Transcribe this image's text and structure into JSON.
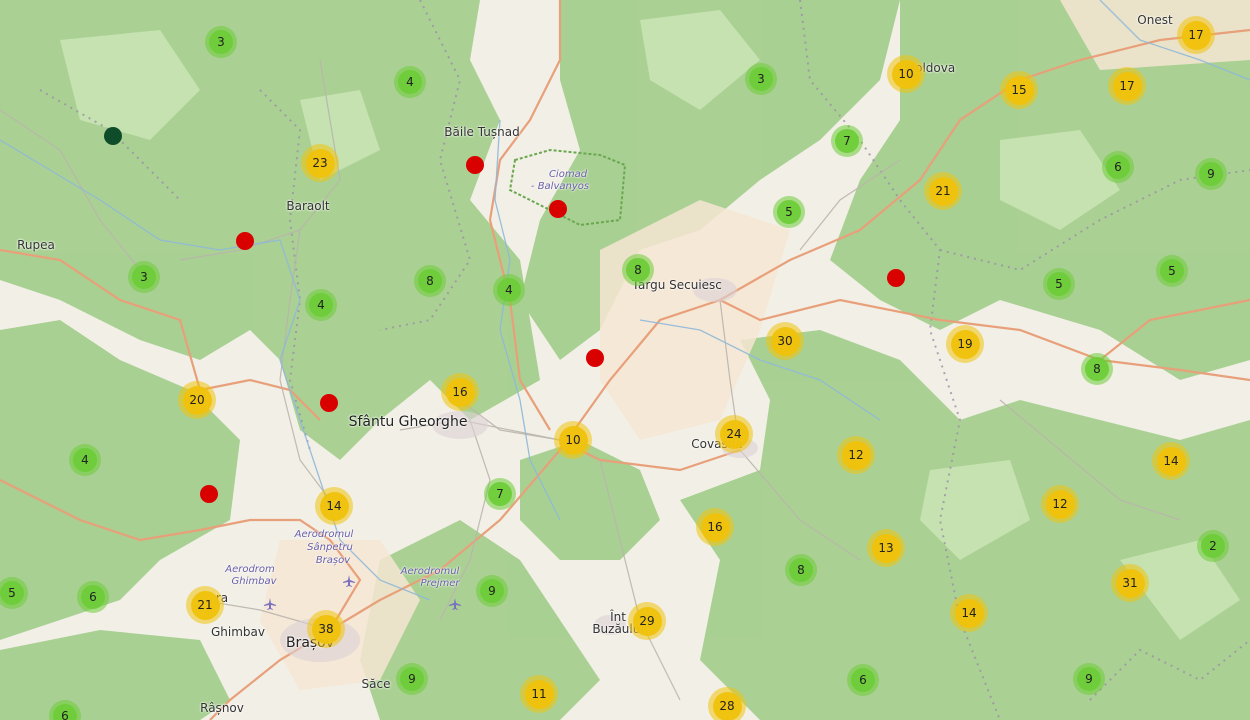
{
  "colors": {
    "green_cluster": "#6ecc39",
    "yellow_cluster": "#f0c20c",
    "red_marker": "#d90000",
    "darkgreen_marker": "#0f4d2a",
    "forest": "#a5cf8e",
    "land": "#f2efe6"
  },
  "places": [
    {
      "name": "Băile Tușnad",
      "cls": "city"
    },
    {
      "name": "Ciomad",
      "cls": "italic"
    },
    {
      "name": "- Balvanyos",
      "cls": "italic"
    },
    {
      "name": "Baraolt",
      "cls": "city"
    },
    {
      "name": "Rupea",
      "cls": "city"
    },
    {
      "name": "Moldova",
      "cls": "city"
    },
    {
      "name": "Onest",
      "cls": "city"
    },
    {
      "name": "Târgu Secuiesc",
      "cls": "city"
    },
    {
      "name": "Sfântu Gheorghe",
      "cls": "big"
    },
    {
      "name": "Covasna",
      "cls": "city"
    },
    {
      "name": "Aerodromul",
      "cls": "italic"
    },
    {
      "name": "Sânpetru",
      "cls": "italic"
    },
    {
      "name": "Brașov",
      "cls": "italic"
    },
    {
      "name": "Aerodrom",
      "cls": "italic"
    },
    {
      "name": "Ghimbav",
      "cls": "italic"
    },
    {
      "name": "Aerodromul",
      "cls": "italic"
    },
    {
      "name": "Prejmer",
      "cls": "italic"
    },
    {
      "name": "Ghimbav",
      "cls": "city"
    },
    {
      "name": "Brașov",
      "cls": "big"
    },
    {
      "name": "Înt",
      "cls": "city"
    },
    {
      "name": "Buzăului",
      "cls": "city"
    },
    {
      "name": "Săce",
      "cls": "city"
    },
    {
      "name": "Râșnov",
      "cls": "city"
    },
    {
      "name": "ra",
      "cls": "city"
    }
  ],
  "clusters": [
    {
      "count": "3",
      "level": "green"
    },
    {
      "count": "4",
      "level": "green"
    },
    {
      "count": "3",
      "level": "green"
    },
    {
      "count": "10",
      "level": "yellow"
    },
    {
      "count": "15",
      "level": "yellow"
    },
    {
      "count": "17",
      "level": "yellow"
    },
    {
      "count": "17",
      "level": "yellow"
    },
    {
      "count": "23",
      "level": "yellow"
    },
    {
      "count": "7",
      "level": "green"
    },
    {
      "count": "6",
      "level": "green"
    },
    {
      "count": "9",
      "level": "green"
    },
    {
      "count": "21",
      "level": "yellow"
    },
    {
      "count": "5",
      "level": "green"
    },
    {
      "count": "3",
      "level": "green"
    },
    {
      "count": "8",
      "level": "green"
    },
    {
      "count": "4",
      "level": "green"
    },
    {
      "count": "8",
      "level": "green"
    },
    {
      "count": "5",
      "level": "green"
    },
    {
      "count": "5",
      "level": "green"
    },
    {
      "count": "4",
      "level": "green"
    },
    {
      "count": "30",
      "level": "yellow"
    },
    {
      "count": "19",
      "level": "yellow"
    },
    {
      "count": "8",
      "level": "green"
    },
    {
      "count": "20",
      "level": "yellow"
    },
    {
      "count": "16",
      "level": "yellow"
    },
    {
      "count": "10",
      "level": "yellow"
    },
    {
      "count": "24",
      "level": "yellow"
    },
    {
      "count": "12",
      "level": "yellow"
    },
    {
      "count": "14",
      "level": "yellow"
    },
    {
      "count": "4",
      "level": "green"
    },
    {
      "count": "7",
      "level": "green"
    },
    {
      "count": "14",
      "level": "yellow"
    },
    {
      "count": "12",
      "level": "yellow"
    },
    {
      "count": "16",
      "level": "yellow"
    },
    {
      "count": "13",
      "level": "yellow"
    },
    {
      "count": "2",
      "level": "green"
    },
    {
      "count": "5",
      "level": "green"
    },
    {
      "count": "6",
      "level": "green"
    },
    {
      "count": "21",
      "level": "yellow"
    },
    {
      "count": "8",
      "level": "green"
    },
    {
      "count": "9",
      "level": "green"
    },
    {
      "count": "31",
      "level": "yellow"
    },
    {
      "count": "29",
      "level": "yellow"
    },
    {
      "count": "14",
      "level": "yellow"
    },
    {
      "count": "38",
      "level": "yellow"
    },
    {
      "count": "9",
      "level": "green"
    },
    {
      "count": "11",
      "level": "yellow"
    },
    {
      "count": "28",
      "level": "yellow"
    },
    {
      "count": "6",
      "level": "green"
    },
    {
      "count": "9",
      "level": "green"
    },
    {
      "count": "6",
      "level": "green"
    }
  ],
  "markers": [
    {
      "kind": "darkgreen"
    },
    {
      "kind": "red"
    },
    {
      "kind": "red"
    },
    {
      "kind": "red"
    },
    {
      "kind": "red"
    },
    {
      "kind": "red"
    },
    {
      "kind": "red"
    },
    {
      "kind": "red"
    }
  ]
}
